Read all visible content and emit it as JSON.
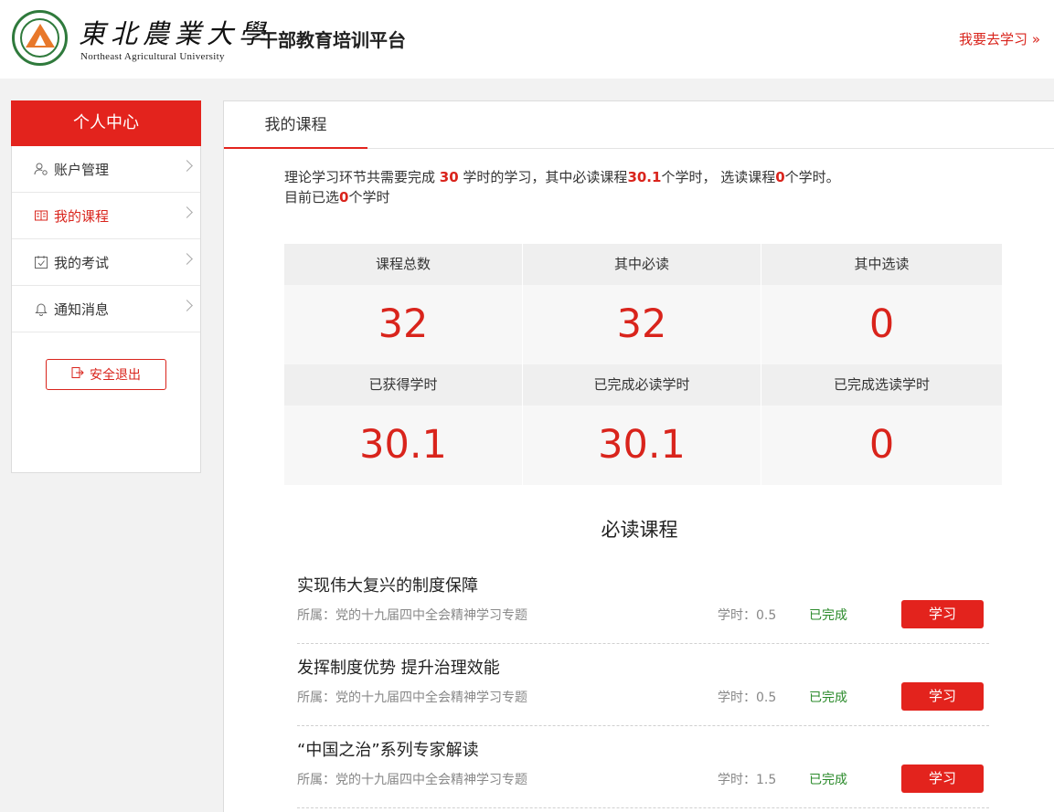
{
  "header": {
    "univ_cn": "東北農業大學",
    "univ_en": "Northeast Agricultural University",
    "platform_title": "干部教育培训平台",
    "go_study": "我要去学习 »"
  },
  "sidebar": {
    "title": "个人中心",
    "items": [
      {
        "label": "账户管理",
        "icon": "user-gear-icon",
        "active": false
      },
      {
        "label": "我的课程",
        "icon": "book-icon",
        "active": true
      },
      {
        "label": "我的考试",
        "icon": "calendar-check-icon",
        "active": false
      },
      {
        "label": "通知消息",
        "icon": "bell-icon",
        "active": false
      }
    ],
    "logout": "安全退出"
  },
  "main": {
    "tab": "我的课程",
    "summary": {
      "p1": "理论学习环节共需要完成 ",
      "total_hours": "30",
      "p2": " 学时的学习，其中必读课程",
      "required_hours": "30.1",
      "p3": "个学时， 选读课程",
      "elective_hours": "0",
      "p4": "个学时。",
      "p5": "目前已选",
      "selected_hours": "0",
      "p6": "个学时"
    },
    "stats": {
      "row1": [
        {
          "label": "课程总数",
          "value": "32"
        },
        {
          "label": "其中必读",
          "value": "32"
        },
        {
          "label": "其中选读",
          "value": "0"
        }
      ],
      "row2": [
        {
          "label": "已获得学时",
          "value": "30.1"
        },
        {
          "label": "已完成必读学时",
          "value": "30.1"
        },
        {
          "label": "已完成选读学时",
          "value": "0"
        }
      ]
    },
    "section_title": "必读课程",
    "courses": [
      {
        "title": "实现伟大复兴的制度保障",
        "belong": "所属：党的十九届四中全会精神学习专题",
        "hours": "学时：0.5",
        "status": "已完成",
        "button": "学习"
      },
      {
        "title": "发挥制度优势 提升治理效能",
        "belong": "所属：党的十九届四中全会精神学习专题",
        "hours": "学时：0.5",
        "status": "已完成",
        "button": "学习"
      },
      {
        "title": "“中国之治”系列专家解读",
        "belong": "所属：党的十九届四中全会精神学习专题",
        "hours": "学时：1.5",
        "status": "已完成",
        "button": "学习"
      }
    ]
  },
  "colors": {
    "brand_red": "#e3231d",
    "status_green": "#2a8a2a",
    "logo_green": "#2f7a3c"
  }
}
